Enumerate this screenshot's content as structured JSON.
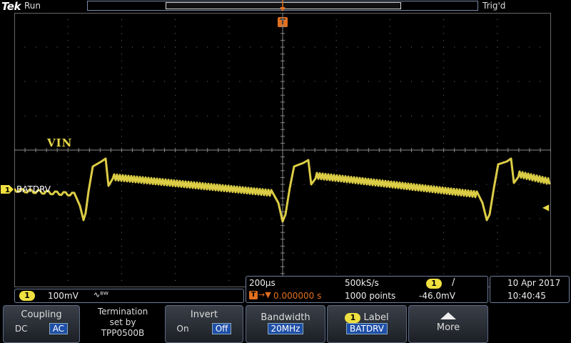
{
  "top": {
    "brand": "Tek",
    "run_status": "Run",
    "trigger_status": "Trig'd",
    "trigger_marker": "T"
  },
  "waveform": {
    "annotation": "VIN",
    "channel_number": "1",
    "channel_label": "BATDRV",
    "trace_color": "#e8d84a"
  },
  "readouts": {
    "channel": {
      "number": "1",
      "scale": "100mV",
      "bandwidth_icon": "bandwidth-limit-icon",
      "bandwidth_symbol": "∿ᴮᵂ"
    },
    "timebase": {
      "time_per_div": "200µs",
      "sample_rate": "500kS/s",
      "trigger_channel": "1",
      "trigger_slope": "/",
      "trigger_position": "0.000000 s",
      "record_length": "1000 points",
      "trigger_level": "-46.0mV"
    },
    "datetime": {
      "date": "10 Apr  2017",
      "time": "10:40:45"
    }
  },
  "menu": {
    "coupling": {
      "title": "Coupling",
      "opt_dc": "DC",
      "opt_ac": "AC",
      "selected": "AC"
    },
    "termination": {
      "line1": "Termination",
      "line2": "set by",
      "line3": "TPP0500B"
    },
    "invert": {
      "title": "Invert",
      "opt_on": "On",
      "opt_off": "Off",
      "selected": "Off"
    },
    "bandwidth": {
      "title": "Bandwidth",
      "value": "20MHz"
    },
    "label": {
      "channel": "1",
      "title": "Label",
      "value": "BATDRV"
    },
    "more": {
      "title": "More"
    }
  },
  "colors": {
    "accent": "#1f4fa8",
    "channel1": "#f0e040",
    "trigger": "#e07020"
  }
}
